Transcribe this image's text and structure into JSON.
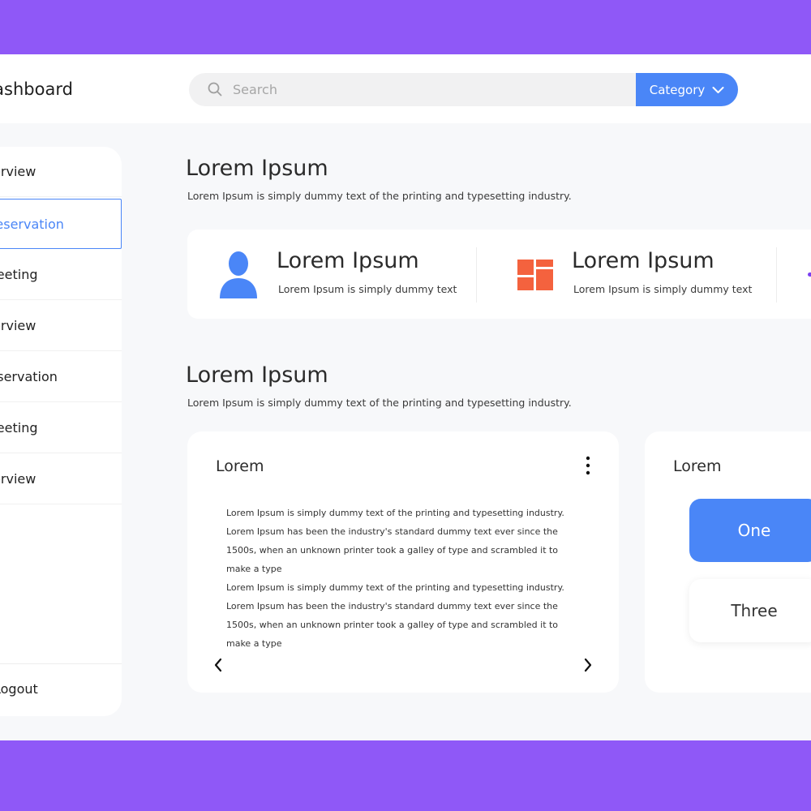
{
  "app": {
    "title": "Dashboard"
  },
  "search": {
    "placeholder": "Search",
    "category_label": "Category"
  },
  "sidebar": {
    "items": [
      {
        "label": "Overview"
      },
      {
        "label": "Reservation",
        "active": true
      },
      {
        "label": "Meeting"
      },
      {
        "label": "Overview"
      },
      {
        "label": "Reservation"
      },
      {
        "label": "Meeting"
      },
      {
        "label": "Overview"
      }
    ],
    "logout_label": "Logout"
  },
  "section1": {
    "title": "Lorem Ipsum",
    "subtitle": "Lorem Ipsum is simply dummy text of the printing and typesetting industry."
  },
  "stats": [
    {
      "title": "Lorem Ipsum",
      "subtitle": "Lorem Ipsum is simply dummy text",
      "icon": "user-icon"
    },
    {
      "title": "Lorem Ipsum",
      "subtitle": "Lorem Ipsum is simply dummy text",
      "icon": "layout-grid-icon"
    }
  ],
  "section2": {
    "title": "Lorem Ipsum",
    "subtitle": "Lorem Ipsum is simply dummy text of the printing and typesetting industry."
  },
  "card1": {
    "title": "Lorem",
    "paragraphs": [
      "Lorem Ipsum is simply dummy text of the printing and typesetting industry. Lorem Ipsum has been the industry's standard dummy text ever since the 1500s, when an unknown printer took a galley of type and scrambled it to make a type",
      "Lorem Ipsum is simply dummy text of the printing and typesetting industry. Lorem Ipsum has been the industry's standard dummy text ever since the 1500s, when an unknown printer took a galley of type and scrambled it to make a type"
    ]
  },
  "card2": {
    "title": "Lorem",
    "options": [
      {
        "label": "One",
        "selected": true
      },
      {
        "label": "Three",
        "selected": false
      }
    ]
  },
  "colors": {
    "accent": "#4a86f7",
    "frame": "#8f58f7",
    "icon_orange": "#f4623e",
    "background": "#f7f8fa"
  }
}
